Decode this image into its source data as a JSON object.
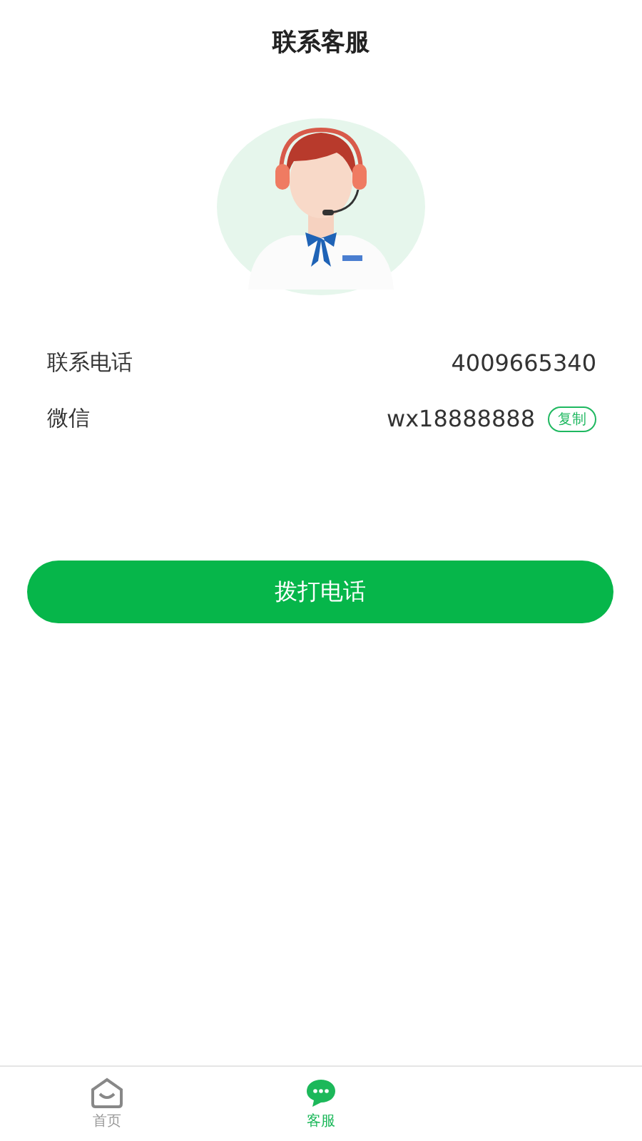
{
  "header": {
    "title": "联系客服"
  },
  "contact_rows": [
    {
      "kind": "text",
      "label": "联系电话",
      "value": "4009665340"
    },
    {
      "kind": "copy",
      "label": "微信",
      "value": "wx18888888",
      "action": "复制"
    }
  ],
  "call_button": {
    "label": "拨打电话"
  },
  "tab_bar": [
    {
      "kind": "home",
      "label": "首页",
      "selected": false
    },
    {
      "kind": "chat",
      "label": "客服",
      "selected": true
    }
  ]
}
